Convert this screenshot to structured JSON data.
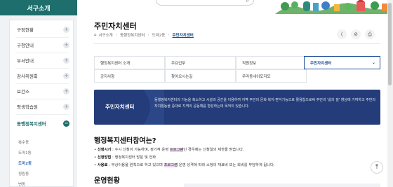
{
  "sidebar": {
    "title": "서구소개",
    "items": [
      {
        "label": "구정현황",
        "icon": "+"
      },
      {
        "label": "구청안내",
        "icon": "+"
      },
      {
        "label": "부서안내",
        "icon": "+"
      },
      {
        "label": "감사위원회",
        "icon": "+"
      },
      {
        "label": "보건소",
        "icon": "+"
      },
      {
        "label": "평생학습원",
        "icon": "+"
      },
      {
        "label": "동행정복지센터",
        "icon": "−"
      }
    ],
    "subitems": [
      "복수동",
      "도마1동",
      "도마2동",
      "정림동",
      "변동"
    ]
  },
  "header": {
    "search_icon": "⌕"
  },
  "main": {
    "title": "주민자치센터",
    "breadcrumb": {
      "home_icon": "⌂",
      "items": [
        "서구소개",
        "동행정복지센터",
        "도마2동",
        "주민자치센터"
      ]
    },
    "tools": {
      "share": "⟨",
      "link": "⊘",
      "print": "⎙"
    },
    "tabs": [
      "행정복지센터 소개",
      "주요업무",
      "직원정보",
      "주민자치센터",
      "공지사항",
      "찾아오시는길",
      "우리동네이모저모"
    ],
    "active_tab_arrow": "⌄",
    "banner": {
      "title": "주민자치센터",
      "text": "동행정복지센터의 기능을 축소하고 시설과 공간을 이용하여 지역 주민의 문화·복지·편익기능으로 활용함으로써 주민의 '삶의 질' 향상에 기여하고 주민의 자치활동을 증대로 지역의 공동체를 형성하는데 목적이 있습니다."
    },
    "section_title": "행정복지센터참여는?",
    "bullets": [
      {
        "label": "신청시기",
        "pre": " : 수시 신청이 가능하며, 정기적 운영 ",
        "hl": "프로그램",
        "post": "인 경우에는 신청일의 제한을 받습니다."
      },
      {
        "label": "신청방법",
        "pre": " : 행정복지센터 방문 및 전화",
        "hl": "",
        "post": ""
      },
      {
        "label": "사용료",
        "pre": " : 무상이용을 원칙으로 하고 있으며 ",
        "hl": "프로그램",
        "post": " 운영 성격에 따라 소정의 재료비 또는 회비를 부담하게 됩니다."
      }
    ],
    "section2_title": "운영현황"
  },
  "top_button": "⤒"
}
